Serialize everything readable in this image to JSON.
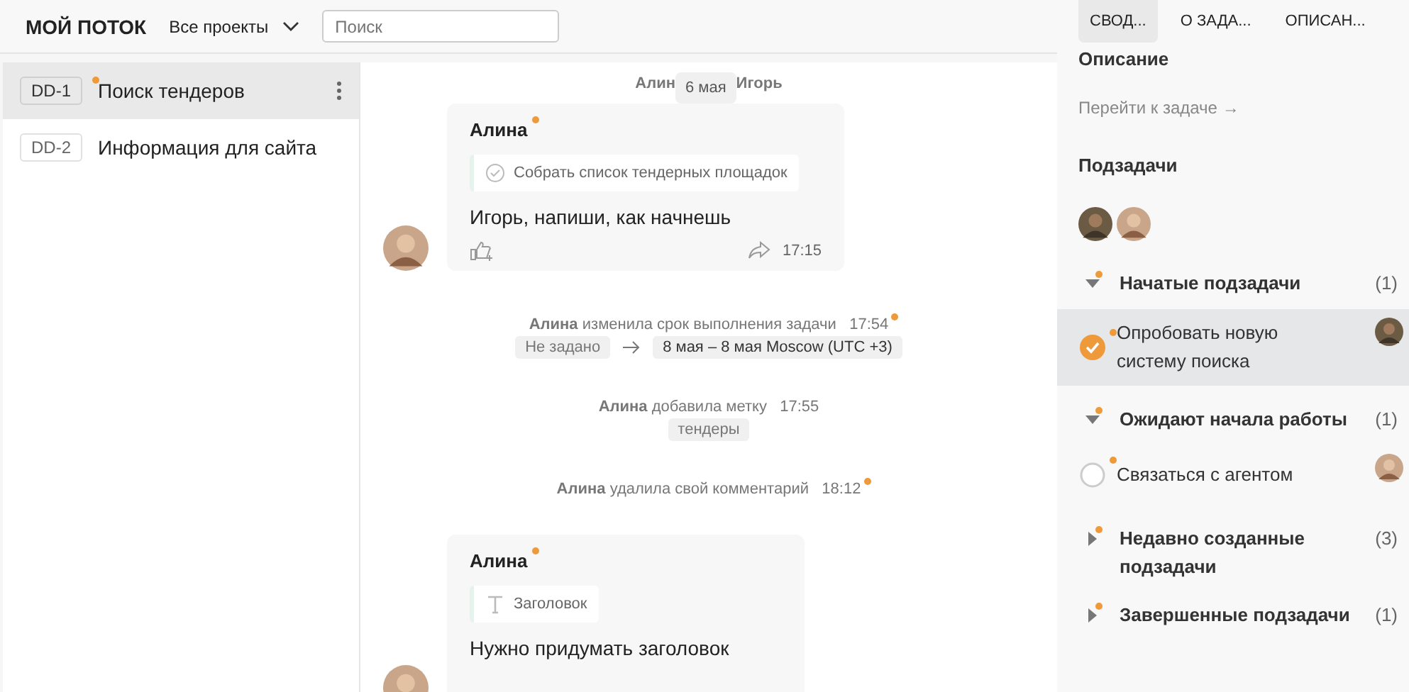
{
  "header": {
    "title": "МОЙ ПОТОК",
    "project_filter": "Все проекты",
    "search": {
      "placeholder": "Поиск"
    }
  },
  "tasks": [
    {
      "key": "DD-1",
      "title": "Поиск тендеров",
      "selected": true,
      "unread": true
    },
    {
      "key": "DD-2",
      "title": "Информация для сайта",
      "selected": false
    }
  ],
  "feed": {
    "participants": [
      "Алин",
      "Игорь"
    ],
    "date": "6 мая",
    "events": [
      {
        "kind": "comment",
        "author": "Алина",
        "unread": true,
        "quote": {
          "kind": "task",
          "text": "Собрать список тендерных площадок"
        },
        "text": "Игорь, напиши, как начнешь",
        "time": "17:15"
      },
      {
        "kind": "change",
        "author": "Алина",
        "action": "изменила срок выполнения задачи",
        "time": "17:54",
        "unread": true,
        "from": "Не задано",
        "to": "8 мая – 8 мая Moscow (UTC +3)"
      },
      {
        "kind": "label",
        "author": "Алина",
        "action": "добавила метку",
        "time": "17:55",
        "label": "тендеры"
      },
      {
        "kind": "note",
        "author": "Алина",
        "action": "удалила свой комментарий",
        "time": "18:12",
        "unread": true
      },
      {
        "kind": "comment",
        "author": "Алина",
        "unread": true,
        "quote": {
          "kind": "heading",
          "text": "Заголовок"
        },
        "text": "Нужно придумать заголовок"
      }
    ]
  },
  "details": {
    "tabs": [
      {
        "label": "СВОД...",
        "selected": true
      },
      {
        "label": "О ЗАДА...",
        "selected": false
      },
      {
        "label": "ОПИСАН...",
        "selected": false
      }
    ],
    "description_title": "Описание",
    "task_link": "Перейти к задаче →",
    "subtasks_title": "Подзадачи",
    "groups": [
      {
        "title": "Начатые подзадачи",
        "count": "(1)",
        "expanded": true,
        "unread": true,
        "children": [
          {
            "title": "Опробовать новую систему поиска",
            "done": true,
            "unread": true,
            "highlighted": true
          }
        ]
      },
      {
        "title": "Ожидают начала работы",
        "count": "(1)",
        "expanded": true,
        "unread": true,
        "children": [
          {
            "title": "Связаться с агентом",
            "done": false,
            "unread": true,
            "highlighted": false
          }
        ]
      },
      {
        "title": "Недавно созданные подзадачи",
        "count": "(3)",
        "expanded": false,
        "unread": true
      },
      {
        "title": "Завершенные подзадачи",
        "count": "(1)",
        "expanded": false,
        "unread": true
      }
    ]
  }
}
